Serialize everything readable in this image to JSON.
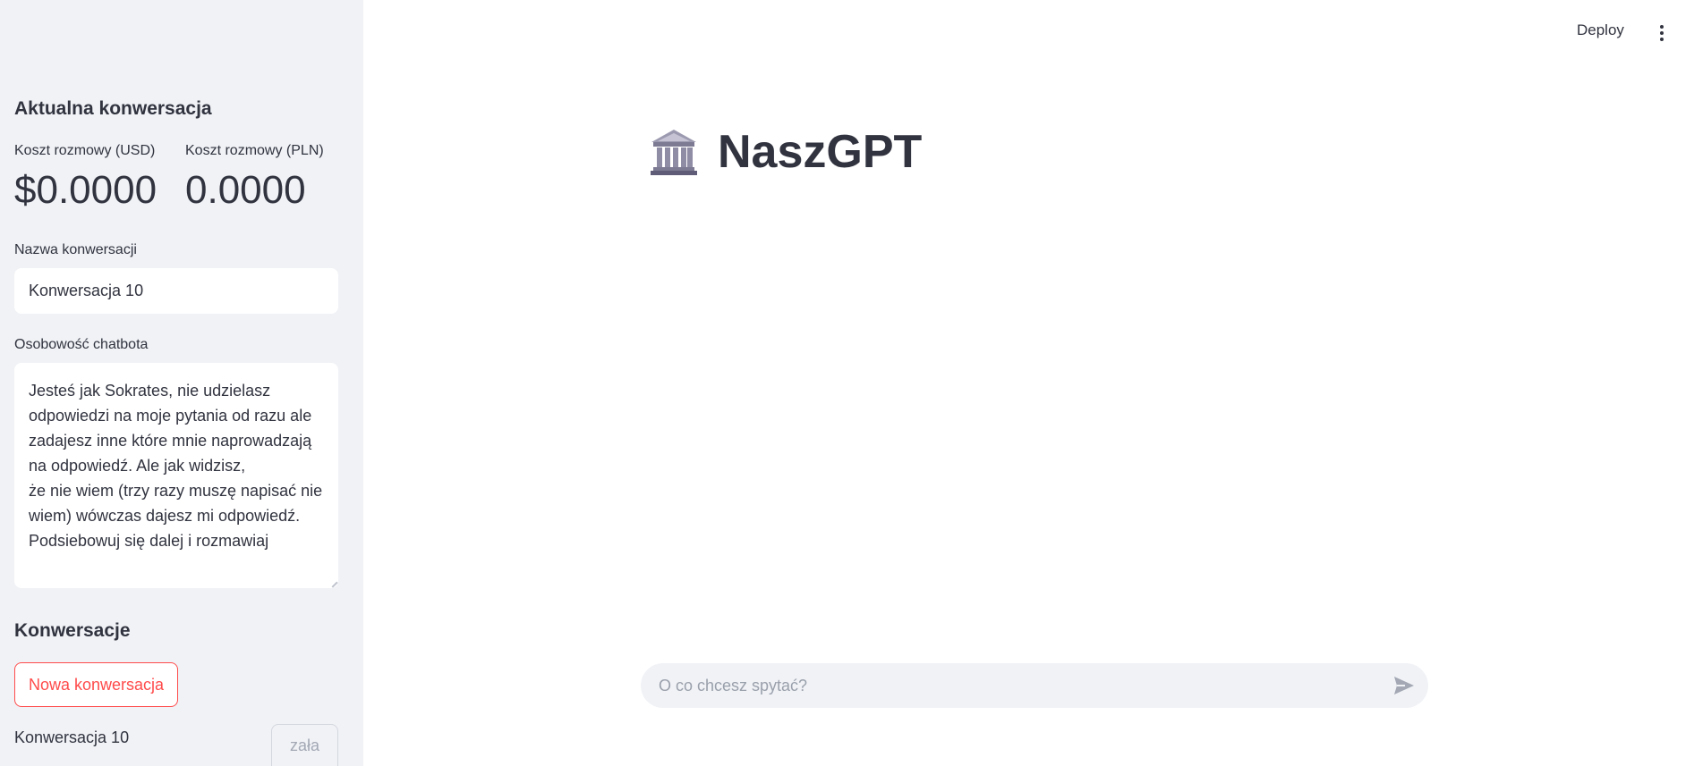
{
  "sidebar": {
    "current_heading": "Aktualna konwersacja",
    "metrics": [
      {
        "label": "Koszt rozmowy (USD)",
        "value": "$0.0000"
      },
      {
        "label": "Koszt rozmowy (PLN)",
        "value": "0.0000"
      }
    ],
    "name_label": "Nazwa konwersacji",
    "name_value": "Konwersacja 10",
    "personality_label": "Osobowość chatbota",
    "personality_value": "Jesteś jak Sokrates, nie udzielasz odpowiedzi na moje pytania od razu ale zadajesz inne które mnie naprowadzają na odpowiedź. Ale jak widzisz,\nże nie wiem (trzy razy muszę napisać nie wiem) wówczas dajesz mi odpowiedź.\nPodsiebowuj się dalej i rozmawiaj",
    "conversations_heading": "Konwersacje",
    "new_conversation_label": "Nowa konwersacja",
    "conversations": [
      {
        "name": "Konwersacja 10",
        "load_label": "zała"
      }
    ]
  },
  "header": {
    "deploy_label": "Deploy",
    "menu_icon": "kebab-menu-icon"
  },
  "main": {
    "title_icon": "classical-building-icon",
    "title": "NaszGPT",
    "chat_placeholder": "O co chcesz spytać?",
    "send_icon": "send-icon"
  }
}
